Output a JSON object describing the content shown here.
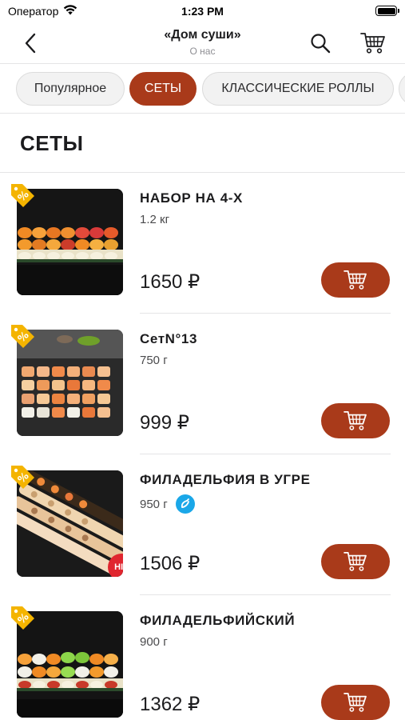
{
  "status_bar": {
    "carrier": "Оператор",
    "time": "1:23 PM",
    "battery_level": 1.0
  },
  "nav": {
    "title": "«Дом суши»",
    "subtitle": "О нас",
    "icons": [
      "chevron-left-icon",
      "search-icon",
      "cart-icon"
    ]
  },
  "categories": [
    {
      "label": "Популярное",
      "active": false
    },
    {
      "label": "СЕТЫ",
      "active": true
    },
    {
      "label": "КЛАССИЧЕСКИЕ РОЛЛЫ",
      "active": false
    }
  ],
  "section": {
    "title": "СЕТЫ"
  },
  "products": [
    {
      "name": "НАБОР НА 4-Х",
      "weight": "1.2 кг",
      "price": "1650 ₽",
      "discount_tag": true,
      "hit": false,
      "spicy_icon": false
    },
    {
      "name": "СетN°13",
      "weight": "750 г",
      "price": "999 ₽",
      "discount_tag": true,
      "hit": false,
      "spicy_icon": false
    },
    {
      "name": "ФИЛАДЕЛЬФИЯ В УГРЕ",
      "weight": "950 г",
      "price": "1506 ₽",
      "discount_tag": true,
      "hit": true,
      "hit_label": "HIT",
      "spicy_icon": true
    },
    {
      "name": "ФИЛАДЕЛЬФИЙСКИЙ",
      "weight": "900 г",
      "price": "1362 ₽",
      "discount_tag": true,
      "hit": false,
      "spicy_icon": false
    }
  ],
  "colors": {
    "accent": "#a93a1a",
    "discount_tag": "#f4b400",
    "hit_badge": "#e0262f",
    "spicy_icon": "#1aa7e8"
  }
}
